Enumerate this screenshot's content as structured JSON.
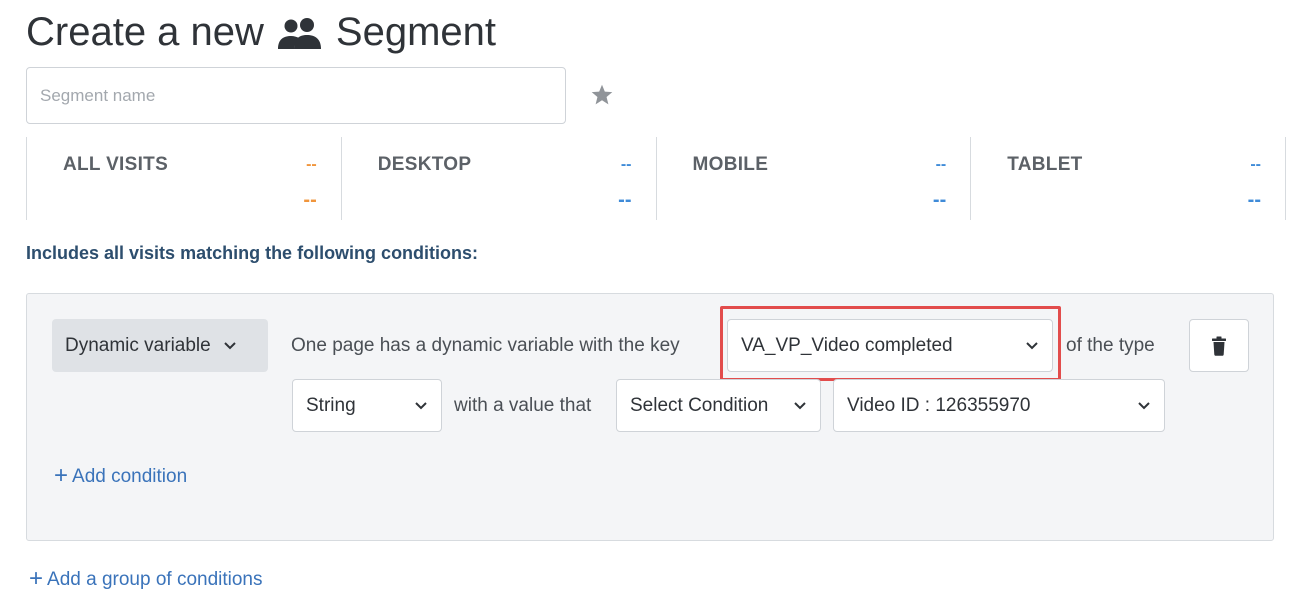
{
  "title": {
    "prefix": "Create a new",
    "suffix": "Segment"
  },
  "segment_name": {
    "value": "",
    "placeholder": "Segment name"
  },
  "stats": [
    {
      "label": "ALL VISITS",
      "small": "--",
      "big": "--",
      "color": "#f0953c"
    },
    {
      "label": "DESKTOP",
      "small": "--",
      "big": "--",
      "color": "#3f8bd8"
    },
    {
      "label": "MOBILE",
      "small": "--",
      "big": "--",
      "color": "#3f8bd8"
    },
    {
      "label": "TABLET",
      "small": "--",
      "big": "--",
      "color": "#3f8bd8"
    }
  ],
  "includes_text": "Includes all visits matching the following conditions:",
  "condition": {
    "type_select": "Dynamic variable",
    "text_key": "One page has a dynamic variable with the key",
    "key_value": "VA_VP_Video completed",
    "text_type": "of the type",
    "type_value": "String",
    "text_value": "with a value that",
    "condition_value": "Select Condition",
    "value_value": "Video ID : 126355970"
  },
  "add_condition": "Add condition",
  "add_group": "Add a group of conditions",
  "colors": {
    "highlight": "#e24c4c",
    "link": "#3a73ba",
    "accent_orange": "#f0953c",
    "accent_blue": "#3f8bd8"
  },
  "icons": [
    "people-icon",
    "star-icon",
    "chevron-down-icon",
    "trash-icon",
    "plus-icon"
  ]
}
